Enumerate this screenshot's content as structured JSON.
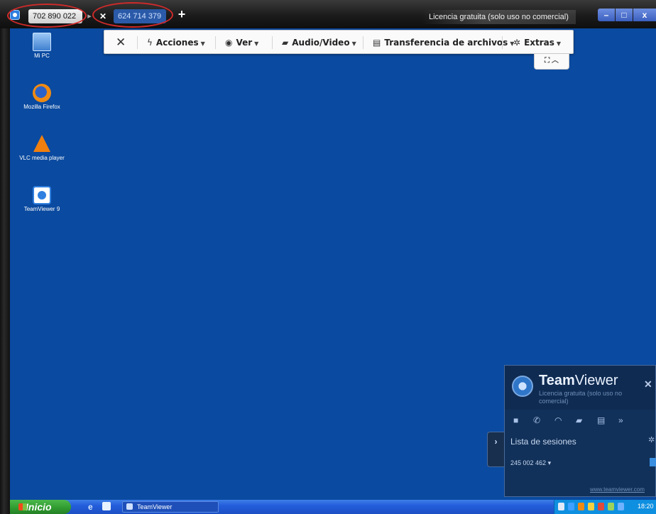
{
  "tabs": [
    {
      "id": "702 890 022"
    },
    {
      "id": "624 714 379"
    }
  ],
  "license_text": "Licencia gratuita (solo uso no comercial)",
  "toolbar": {
    "acciones": "Acciones",
    "ver": "Ver",
    "audio_video": "Audio/Video",
    "transferencia": "Transferencia de archivos",
    "extras": "Extras"
  },
  "desktop_icons": {
    "mipc": "Mi PC",
    "firefox": "Mozilla Firefox",
    "vlc": "VLC media player",
    "teamviewer": "TeamViewer 9"
  },
  "tv_panel": {
    "title_bold": "Team",
    "title_light": "Viewer",
    "subtitle": "Licencia gratuita (solo uso no comercial)",
    "list_label": "Lista de sesiones",
    "session_id": "245 002 462",
    "url": "www.teamviewer.com"
  },
  "taskbar": {
    "start_label": "Inicio",
    "task_label": "TeamViewer",
    "clock": "18:20"
  },
  "colors": {
    "desktop": "#0a4aa0",
    "annotation": "#d02a2a",
    "tv_panel": "#11315a"
  }
}
